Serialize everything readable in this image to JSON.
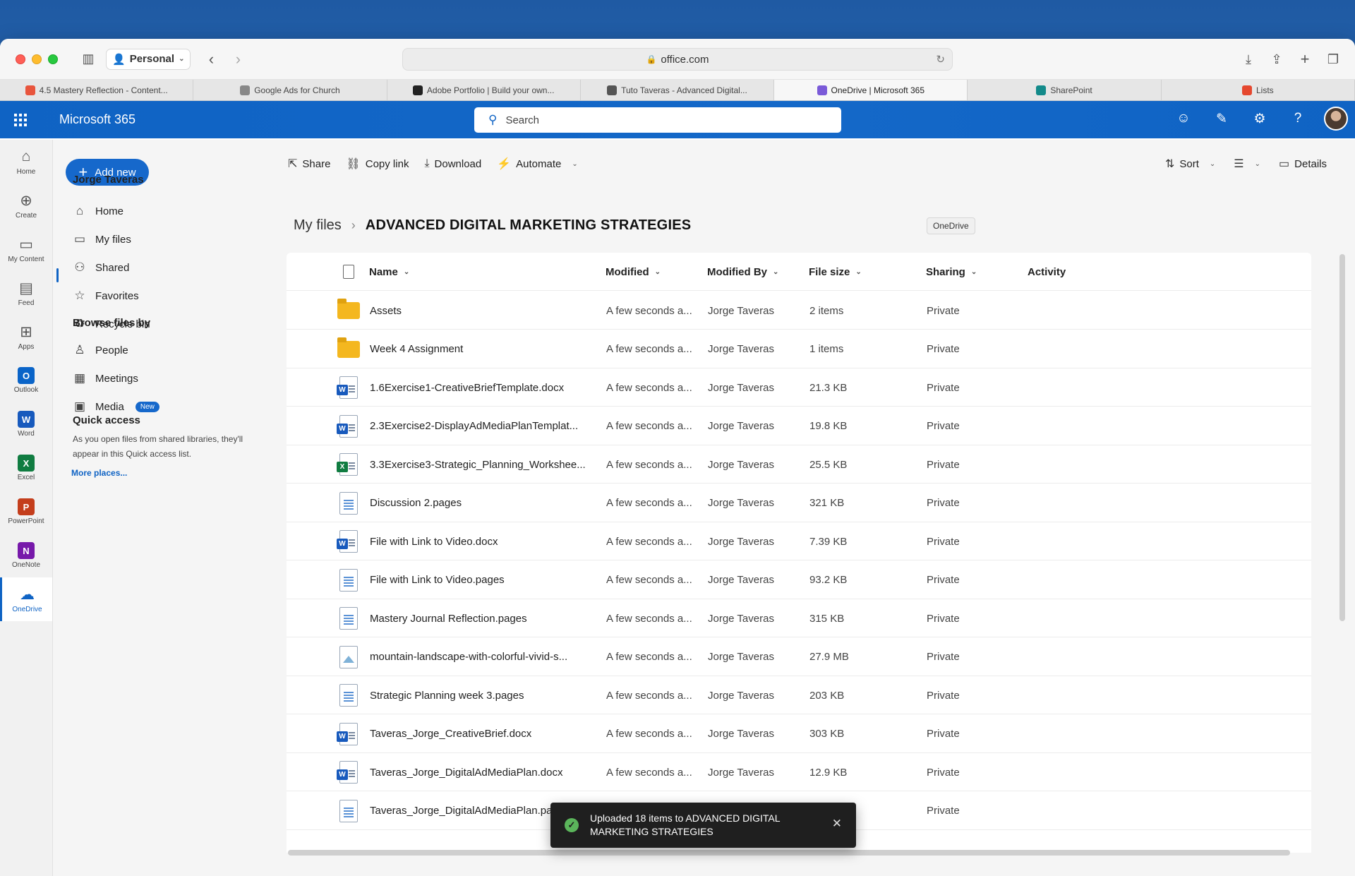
{
  "browser": {
    "profile": "Personal",
    "url": "office.com",
    "tabs": [
      {
        "label": "4.5 Mastery Reflection - Content...",
        "color": "#e8553d",
        "active": false
      },
      {
        "label": "Google Ads for Church",
        "color": "#888888",
        "active": false
      },
      {
        "label": "Adobe Portfolio | Build your own...",
        "color": "#222222",
        "active": false
      },
      {
        "label": "Tuto Taveras - Advanced Digital...",
        "color": "#555555",
        "active": false
      },
      {
        "label": "OneDrive | Microsoft 365",
        "color": "#7a5ad8",
        "active": true
      },
      {
        "label": "SharePoint",
        "color": "#138a8a",
        "active": false
      },
      {
        "label": "Lists",
        "color": "#e5472e",
        "active": false
      }
    ]
  },
  "header": {
    "title": "Microsoft 365",
    "search_placeholder": "Search",
    "brand_color": "#0f63c4"
  },
  "rail": [
    {
      "label": "Home",
      "icon": "home-icon",
      "glyph": "⌂"
    },
    {
      "label": "Create",
      "icon": "create-icon",
      "glyph": "⊕"
    },
    {
      "label": "My Content",
      "icon": "folder-icon",
      "glyph": "▭"
    },
    {
      "label": "Feed",
      "icon": "feed-icon",
      "glyph": "▤"
    },
    {
      "label": "Apps",
      "icon": "apps-icon",
      "glyph": "⊞"
    },
    {
      "label": "Outlook",
      "icon": "outlook-icon",
      "glyph": "O",
      "color": "#0a64c8"
    },
    {
      "label": "Word",
      "icon": "word-icon",
      "glyph": "W",
      "color": "#185abd"
    },
    {
      "label": "Excel",
      "icon": "excel-icon",
      "glyph": "X",
      "color": "#107c41"
    },
    {
      "label": "PowerPoint",
      "icon": "powerpoint-icon",
      "glyph": "P",
      "color": "#c43e1c"
    },
    {
      "label": "OneNote",
      "icon": "onenote-icon",
      "glyph": "N",
      "color": "#7719aa"
    },
    {
      "label": "OneDrive",
      "icon": "onedrive-icon",
      "glyph": "☁",
      "active": true
    }
  ],
  "leftnav": {
    "add_new": "Add new",
    "user_name": "Jorge Taveras",
    "items": [
      {
        "label": "Home",
        "glyph": "⌂"
      },
      {
        "label": "My files",
        "glyph": "▭"
      },
      {
        "label": "Shared",
        "glyph": "⚇"
      },
      {
        "label": "Favorites",
        "glyph": "☆"
      },
      {
        "label": "Recycle bin",
        "glyph": "♻"
      }
    ],
    "browse_heading": "Browse files by",
    "browse_items": [
      {
        "label": "People",
        "glyph": "♙"
      },
      {
        "label": "Meetings",
        "glyph": "▦"
      },
      {
        "label": "Media",
        "glyph": "▣",
        "badge": "New"
      }
    ],
    "quick_access_heading": "Quick access",
    "quick_access_text": "As you open files from shared libraries, they'll appear in this Quick access list.",
    "more_places": "More places..."
  },
  "commands": {
    "share": "Share",
    "copy_link": "Copy link",
    "download": "Download",
    "automate": "Automate",
    "sort": "Sort",
    "details": "Details"
  },
  "breadcrumb": {
    "root": "My files",
    "current": "ADVANCED DIGITAL MARKETING STRATEGIES",
    "tooltip": "OneDrive"
  },
  "columns": {
    "name": "Name",
    "modified": "Modified",
    "modified_by": "Modified By",
    "file_size": "File size",
    "sharing": "Sharing",
    "activity": "Activity"
  },
  "files": [
    {
      "type": "folder",
      "name": "Assets",
      "modified": "A few seconds a...",
      "by": "Jorge Taveras",
      "size": "2 items",
      "sharing": "Private"
    },
    {
      "type": "folder",
      "name": "Week 4 Assignment",
      "modified": "A few seconds a...",
      "by": "Jorge Taveras",
      "size": "1 items",
      "sharing": "Private"
    },
    {
      "type": "word",
      "name": "1.6Exercise1-CreativeBriefTemplate.docx",
      "modified": "A few seconds a...",
      "by": "Jorge Taveras",
      "size": "21.3 KB",
      "sharing": "Private"
    },
    {
      "type": "word",
      "name": "2.3Exercise2-DisplayAdMediaPlanTemplat...",
      "modified": "A few seconds a...",
      "by": "Jorge Taveras",
      "size": "19.8 KB",
      "sharing": "Private"
    },
    {
      "type": "excel",
      "name": "3.3Exercise3-Strategic_Planning_Workshee...",
      "modified": "A few seconds a...",
      "by": "Jorge Taveras",
      "size": "25.5 KB",
      "sharing": "Private"
    },
    {
      "type": "pages",
      "name": "Discussion 2.pages",
      "modified": "A few seconds a...",
      "by": "Jorge Taveras",
      "size": "321 KB",
      "sharing": "Private"
    },
    {
      "type": "word",
      "name": "File with Link to Video.docx",
      "modified": "A few seconds a...",
      "by": "Jorge Taveras",
      "size": "7.39 KB",
      "sharing": "Private"
    },
    {
      "type": "pages",
      "name": "File with Link to Video.pages",
      "modified": "A few seconds a...",
      "by": "Jorge Taveras",
      "size": "93.2 KB",
      "sharing": "Private"
    },
    {
      "type": "pages",
      "name": "Mastery Journal Reflection.pages",
      "modified": "A few seconds a...",
      "by": "Jorge Taveras",
      "size": "315 KB",
      "sharing": "Private"
    },
    {
      "type": "image",
      "name": "mountain-landscape-with-colorful-vivid-s...",
      "modified": "A few seconds a...",
      "by": "Jorge Taveras",
      "size": "27.9 MB",
      "sharing": "Private"
    },
    {
      "type": "pages",
      "name": "Strategic Planning week 3.pages",
      "modified": "A few seconds a...",
      "by": "Jorge Taveras",
      "size": "203 KB",
      "sharing": "Private"
    },
    {
      "type": "word",
      "name": "Taveras_Jorge_CreativeBrief.docx",
      "modified": "A few seconds a...",
      "by": "Jorge Taveras",
      "size": "303 KB",
      "sharing": "Private"
    },
    {
      "type": "word",
      "name": "Taveras_Jorge_DigitalAdMediaPlan.docx",
      "modified": "A few seconds a...",
      "by": "Jorge Taveras",
      "size": "12.9 KB",
      "sharing": "Private"
    },
    {
      "type": "pages",
      "name": "Taveras_Jorge_DigitalAdMediaPlan.pa",
      "modified": "",
      "by": "",
      "size": "",
      "sharing": "Private"
    }
  ],
  "toast": {
    "message": "Uploaded 18 items to ADVANCED DIGITAL MARKETING STRATEGIES"
  }
}
